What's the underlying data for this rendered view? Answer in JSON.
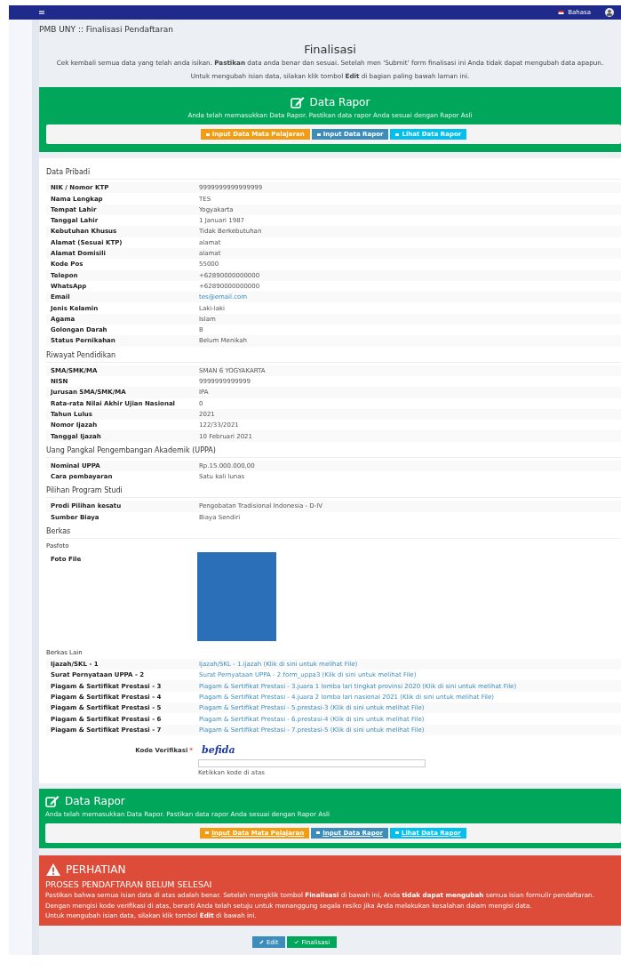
{
  "topbar": {
    "language": "Bahasa"
  },
  "breadcrumb": "PMB UNY :: Finalisasi Pendaftaran",
  "heading": "Finalisasi",
  "intro": [
    "Cek kembali semua data yang telah anda isikan. **Pastikan** data anda benar dan sesuai. Setelah men 'Submit' form finalisasi ini Anda tidak dapat mengubah data apapun.",
    "Untuk mengubah isian data, silakan klik tombol **Edit** di bagian paling bawah laman ini."
  ],
  "rapor_panels": [
    {
      "kind": "center",
      "title": "Data Rapor",
      "text": "Anda telah memasukkan Data Rapor. Pastikan data rapor Anda sesuai dengan Rapor Asli",
      "buttons": [
        {
          "kind": "warning",
          "label": "Input Data Mata Pelajaran"
        },
        {
          "kind": "primary",
          "label": "Input Data Rapor"
        },
        {
          "kind": "info",
          "label": "Lihat Data Rapor"
        }
      ]
    },
    {
      "kind": "left",
      "title": "Data Rapor",
      "text": "Anda telah memasukkan Data Rapor. Pastikan data rapor Anda sesuai dengan Rapor Asli",
      "buttons": [
        {
          "kind": "warning",
          "label": "Input Data Mata Pelajaran"
        },
        {
          "kind": "primary",
          "label": "Input Data Rapor"
        },
        {
          "kind": "info",
          "label": "Lihat Data Rapor"
        }
      ]
    }
  ],
  "sections": [
    {
      "title": "Data Pribadi",
      "rows": [
        {
          "label": "NIK / Nomor KTP",
          "value": "9999999999999999",
          "kind": "text"
        },
        {
          "label": "Nama Lengkap",
          "value": "TES",
          "kind": "text"
        },
        {
          "label": "Tempat Lahir",
          "value": "Yogyakarta",
          "kind": "text"
        },
        {
          "label": "Tanggal Lahir",
          "value": "1 Januari 1987",
          "kind": "text"
        },
        {
          "label": "Kebutuhan Khusus",
          "value": "Tidak Berkebutuhan",
          "kind": "text"
        },
        {
          "label": "Alamat (Sesuai KTP)",
          "value": "alamat",
          "kind": "text"
        },
        {
          "label": "Alamat Domisili",
          "value": "alamat",
          "kind": "text"
        },
        {
          "label": "Kode Pos",
          "value": "55000",
          "kind": "text"
        },
        {
          "label": "Telepon",
          "value": "+62890000000000",
          "kind": "text"
        },
        {
          "label": "WhatsApp",
          "value": "+62890000000000",
          "kind": "text"
        },
        {
          "label": "Email",
          "value": "tes@email.com",
          "kind": "link"
        },
        {
          "label": "Jenis Kelamin",
          "value": "Laki-laki",
          "kind": "text"
        },
        {
          "label": "Agama",
          "value": "Islam",
          "kind": "text"
        },
        {
          "label": "Golongan Darah",
          "value": "B",
          "kind": "text"
        },
        {
          "label": "Status Pernikahan",
          "value": "Belum Menikah",
          "kind": "text"
        }
      ]
    },
    {
      "title": "Riwayat Pendidikan",
      "rows": [
        {
          "label": "SMA/SMK/MA",
          "value": "SMAN 6 YOGYAKARTA",
          "kind": "text"
        },
        {
          "label": "NISN",
          "value": "9999999999999",
          "kind": "text"
        },
        {
          "label": "Jurusan SMA/SMK/MA",
          "value": "IPA",
          "kind": "text"
        },
        {
          "label": "Rata-rata Nilai Akhir Ujian Nasional",
          "value": "0",
          "kind": "text"
        },
        {
          "label": "Tahun Lulus",
          "value": "2021",
          "kind": "text"
        },
        {
          "label": "Nomor Ijazah",
          "value": "122/33/2021",
          "kind": "text"
        },
        {
          "label": "Tanggal Ijazah",
          "value": "10 Februari 2021",
          "kind": "text"
        }
      ]
    },
    {
      "title": "Uang Pangkal Pengembangan Akademik (UPPA)",
      "rows": [
        {
          "label": "Nominal UPPA",
          "value": "Rp.15.000.000,00",
          "kind": "text"
        },
        {
          "label": "Cara pembayaran",
          "value": "Satu kali lunas",
          "kind": "text"
        }
      ]
    },
    {
      "title": "Pilihan Program Studi",
      "rows": [
        {
          "label": "Prodi Pilihan kesatu",
          "value": "Pengobatan Tradisional Indonesia - D-IV",
          "kind": "text"
        },
        {
          "label": "Sumber Biaya",
          "value": "Biaya Sendiri",
          "kind": "text"
        }
      ]
    }
  ],
  "berkas": {
    "title": "Berkas",
    "pasfoto_title": "Pasfoto",
    "photo_label": "Foto File",
    "other_title": "Berkas Lain",
    "files": [
      {
        "label": "Ijazah/SKL - 1",
        "value": "Ijazah/SKL - 1.ijazah (Klik di sini untuk melihat File)"
      },
      {
        "label": "Surat Pernyataan UPPA - 2",
        "value": "Surat Pernyataan UPPA - 2.form_uppa3 (Klik di sini untuk melihat File)"
      },
      {
        "label": "Piagam & Sertifikat Prestasi - 3",
        "value": "Piagam & Sertifikat Prestasi - 3.juara 1 lomba lari tingkat provinsi 2020 (Klik di sini untuk melihat File)"
      },
      {
        "label": "Piagam & Sertifikat Prestasi - 4",
        "value": "Piagam & Sertifikat Prestasi - 4.juara 2 lomba lari nasional 2021 (Klik di sini untuk melihat File)"
      },
      {
        "label": "Piagam & Sertifikat Prestasi - 5",
        "value": "Piagam & Sertifikat Prestasi - 5.prestasi-3 (Klik di sini untuk melihat File)"
      },
      {
        "label": "Piagam & Sertifikat Prestasi - 6",
        "value": "Piagam & Sertifikat Prestasi - 6.prestasi-4 (Klik di sini untuk melihat File)"
      },
      {
        "label": "Piagam & Sertifikat Prestasi - 7",
        "value": "Piagam & Sertifikat Prestasi - 7.prestasi-5 (Klik di sini untuk melihat File)"
      }
    ]
  },
  "verification": {
    "label": "Kode Verifikasi",
    "required_mark": "*",
    "captcha": "befida",
    "hint": "Ketikkan kode di atas"
  },
  "warning": {
    "title": "PERHATIAN",
    "subtitle": "PROSES PENDAFTARAN BELUM SELESAI",
    "paragraphs": [
      "Pastikan bahwa semua isian data di atas adalah benar. Setelah mengklik tombol **Finalisasi** di bawah ini, Anda **tidak dapat mengubah** semua isian formulir pendaftaran.",
      "Dengan mengisi kode verifikasi di atas, berarti Anda telah setuju untuk menanggung segala resiko jika Anda melakukan kesalahan dalam mengisi data.",
      "Untuk mengubah isian data, silakan klik tombol **Edit** di bawah ini."
    ]
  },
  "actions": [
    {
      "kind": "edit",
      "label": "Edit"
    },
    {
      "kind": "finalize",
      "label": "Finalisasi"
    }
  ]
}
